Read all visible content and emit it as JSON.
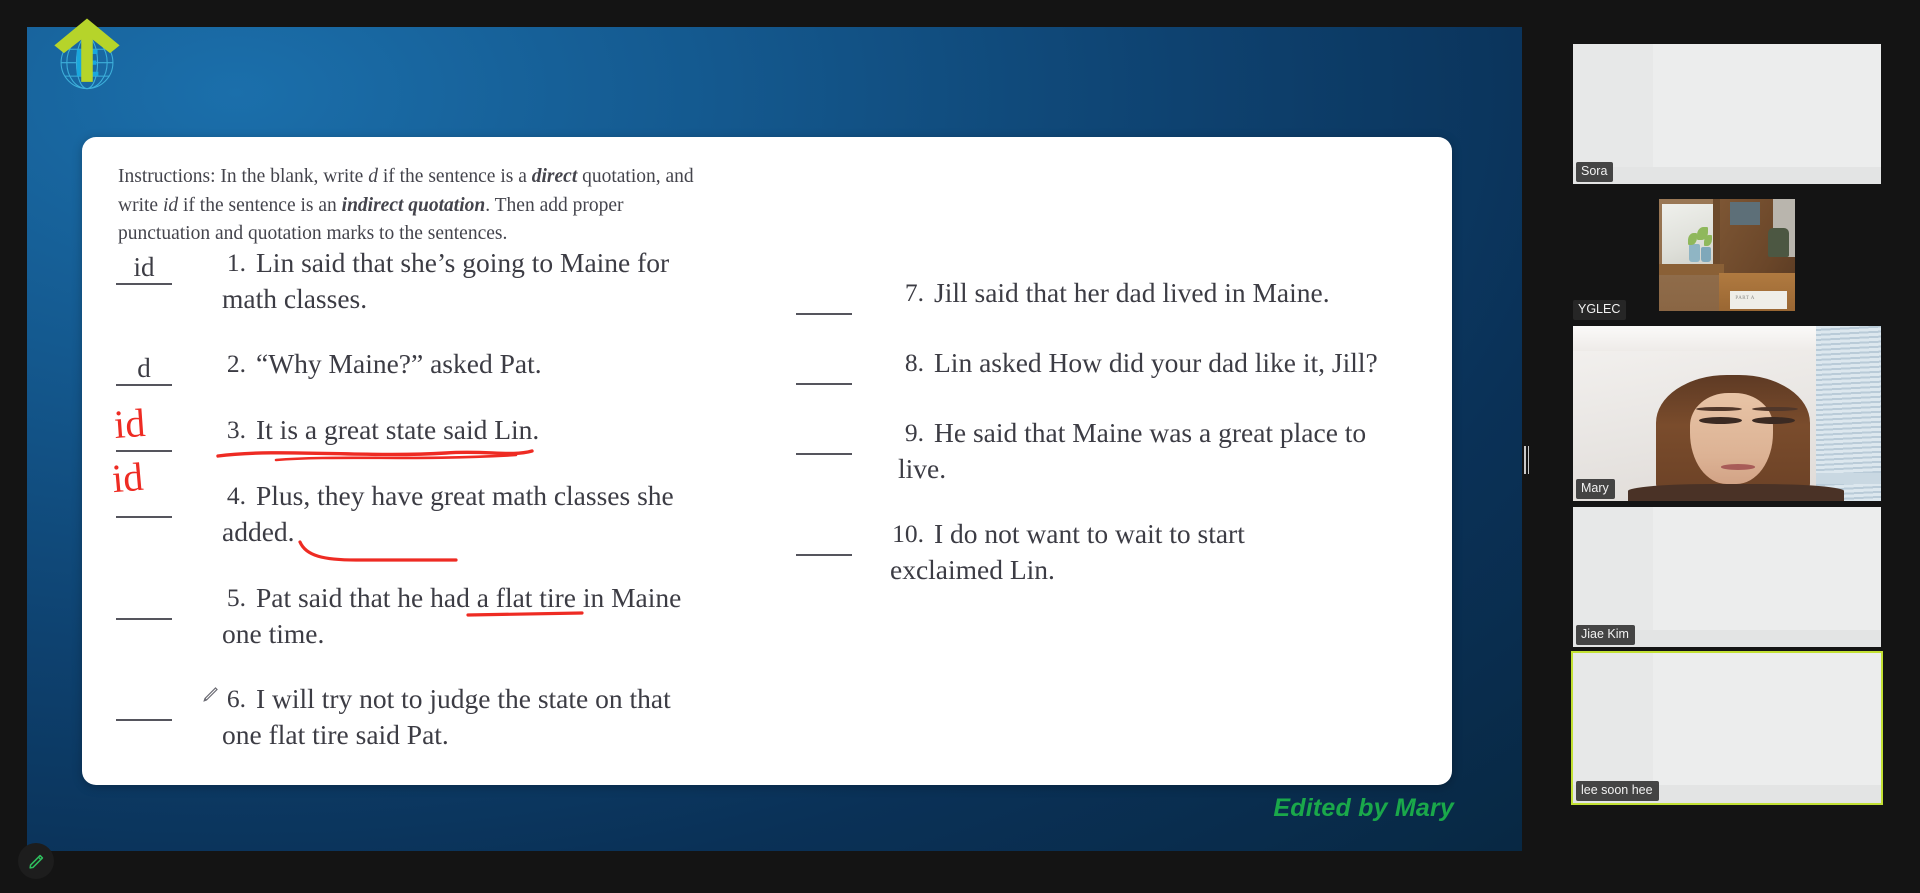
{
  "app": {
    "background_color": "#141414",
    "slide_background": "#0e4270",
    "annotate_tool_icon": "pencil-icon",
    "splitter_icon": "drag-handle-icon"
  },
  "slide": {
    "logo_icon": "arrow-globe-logo-icon",
    "instructions": {
      "lead": "Instructions:",
      "part1": " In the blank, write ",
      "em1": "d",
      "part2": " if the sentence is a ",
      "em2": "direct",
      "part3": " quotation, and write ",
      "em3": "id",
      "part4": " if the sentence is an ",
      "em4": "indirect quotation",
      "part5": ". Then add proper punctuation and quotation marks to the sentences.",
      "full_text": "Instructions: In the blank, write d if the sentence is a direct quotation, and write id if the sentence is an indirect quotation. Then add proper punctuation and quotation marks to the sentences."
    },
    "left_column": [
      {
        "blank": "id",
        "num": "1.",
        "text": "Lin said that she’s going to Maine for math classes.",
        "ink": ""
      },
      {
        "blank": "d",
        "num": "2.",
        "text": "“Why Maine?” asked Pat.",
        "ink": ""
      },
      {
        "blank": "",
        "num": "3.",
        "text": "It is a great state said Lin.",
        "ink": "id"
      },
      {
        "blank": "",
        "num": "4.",
        "text": "Plus, they have great math classes she added.",
        "ink": "id"
      },
      {
        "blank": "",
        "num": "5.",
        "text": "Pat said that he had a flat tire in Maine one time.",
        "ink": ""
      },
      {
        "blank": "",
        "num": "6.",
        "text": "I will try not to judge the state on that one flat tire said Pat.",
        "ink": ""
      }
    ],
    "right_column": [
      {
        "blank": "",
        "num": "7.",
        "text": "Jill said that her dad lived in Maine.",
        "ink": ""
      },
      {
        "blank": "",
        "num": "8.",
        "text": "Lin asked How did your dad like it, Jill?",
        "ink": ""
      },
      {
        "blank": "",
        "num": "9.",
        "text": "He said that Maine was a great place to live.",
        "ink": ""
      },
      {
        "blank": "",
        "num": "10.",
        "text": "I do not want to wait to start exclaimed Lin.",
        "ink": ""
      }
    ],
    "ink_color": "#ee2b23",
    "credit": "Edited by Mary",
    "credit_color": "#1aa84a"
  },
  "sidebar": {
    "participants": [
      {
        "name": "Sora",
        "media": "blank-screen",
        "active": false
      },
      {
        "name": "YGLEC",
        "media": "room-photo",
        "active": false
      },
      {
        "name": "Mary",
        "media": "webcam",
        "active": false
      },
      {
        "name": "Jiae Kim",
        "media": "blank-screen",
        "active": false
      },
      {
        "name": "lee soon hee",
        "media": "blank-screen",
        "active": true
      }
    ],
    "active_border_color": "#c2e033"
  }
}
